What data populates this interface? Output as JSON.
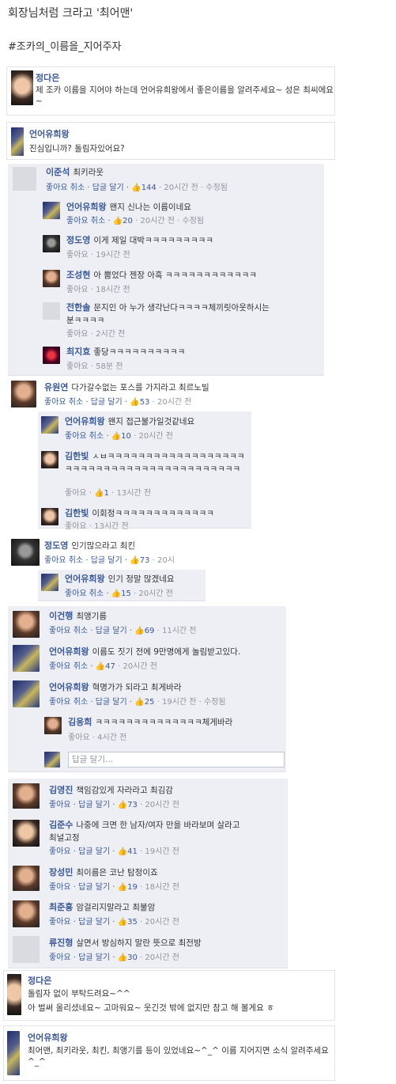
{
  "header": {
    "title": "회장님처럼 크라고 '최어맨'",
    "hashtag": "#조카의_이름을_지어주자"
  },
  "post1": {
    "name": "정다은",
    "text": "제 조카 이름을 지어야 하는데 언어유희왕에서 좋은이름을 알려주세요~ 성은 최씨에요~"
  },
  "post2": {
    "name": "언어유희왕",
    "text": "진심입니까? 돌림자있어요?"
  },
  "labels": {
    "like": "좋아요",
    "cancel": "취소",
    "reply": "답글 달기",
    "reply_placeholder": "답글 달기...",
    "edited": "수정됨"
  },
  "c1": {
    "name": "이준석",
    "text": "최키라웃",
    "meta": "좋아요 취소 · 답글 달기 · ",
    "likes": "144",
    "time": "20시간 전",
    "edited": "수정됨"
  },
  "r1": {
    "name": "언어유희왕",
    "text": "왠지 신나는 이름이네요",
    "meta": "좋아요 취소 · ",
    "likes": "20",
    "time": "20시간 전",
    "edited": "수정됨"
  },
  "r2": {
    "name": "정도영",
    "text": "이게 제일 대박ㅋㅋㅋㅋㅋㅋㅋㅋㅋ",
    "meta": "좋아요 · 19시간 전"
  },
  "r3": {
    "name": "조성현",
    "text": "아 뿜었다 젠장 아흑 ㅋㅋㅋㅋㅋㅋㅋㅋㅋㅋㅋㅋ",
    "meta": "좋아요 · 18시간 전"
  },
  "r4": {
    "name": "전한솔",
    "text": "문지인 아 누가 생각난다ㅋㅋㅋㅋ체끼릿아웃하시는",
    "text2": "분ㅋㅋㅋㅋ",
    "meta": "좋아요 · 2시간 전"
  },
  "r5": {
    "name": "최지효",
    "text": "좋당ㅋㅋㅋㅋㅋㅋㅋㅋㅋㅋ",
    "meta": "좋아요 · 58분 전"
  },
  "c2": {
    "name": "유원연",
    "text": "다가갈수없는 포스를 가지라고 최르노빌",
    "meta": "좋아요 취소 · 답글 달기 · ",
    "likes": "53",
    "time": "20시간 전"
  },
  "r6": {
    "name": "언어유희왕",
    "text": "왠지 접근불가일것같네요",
    "meta": "좋아요 취소 · ",
    "likes": "10",
    "time": "20시간 전"
  },
  "r7": {
    "name": "김한빛",
    "text": "ㅅㅂㅋㅋㅋㅋㅋㅋㅋㅋㅋㅋㅋㅋㅋㅋㅋㅋㅋㅋ",
    "text2": "ㅋㅋㅋㅋㅋㅋㅋㅋㅋㅋㅋㅋㅋㅋㅋㅋㅋㅋㅋㅋㅋㅋㅋ",
    "meta": "좋아요 · ",
    "likes": "1",
    "time": "13시간 전"
  },
  "r8": {
    "name": "김한빛",
    "text": "이회정ㅋㅋㅋㅋㅋㅋㅋㅋㅋㅋㅋㅋㅋ",
    "meta": "좋아요 · 13시간 전"
  },
  "c3": {
    "name": "정도영",
    "text": "인기많으라고 최킨",
    "meta": "좋아요 취소 · 답글 달기 · ",
    "likes": "73",
    "time": "20시"
  },
  "r9": {
    "name": "언어유희왕",
    "text": "인기 정말 많겠네요",
    "meta": "좋아요 취소 · ",
    "likes": "15",
    "time": "20시간 전"
  },
  "c4": {
    "name": "이건행",
    "text": "최앵기름",
    "meta": "좋아요 취소 · 답글 달기 · ",
    "likes": "69",
    "time": "11시간 전"
  },
  "c5": {
    "name": "언어유희왕",
    "text": "이름도 짓기 전에 9만명에게 놀림받고있다.",
    "meta": "좋아요 취소 · ",
    "likes": "47",
    "time": "20시간 전"
  },
  "c6": {
    "name": "언어유희왕",
    "text": "혁명가가 되라고 최게바라",
    "meta": "좋아요 취소 · 답글 달기 · ",
    "likes": "25",
    "time": "19시간 전",
    "edited": "수정됨"
  },
  "r10": {
    "name": "김응희",
    "text": "ㅋㅋㅋㅋㅋㅋㅋㅋㅋㅋㅋㅋㅋㅋ체게바라",
    "meta": "좋아요 · 4시간 전"
  },
  "c7": {
    "name": "김영진",
    "text": "책임감있게 자라라고 최김감",
    "meta": "좋아요 · 답글 달기 · ",
    "likes": "73",
    "time": "20시간 전"
  },
  "c8": {
    "name": "김준수",
    "text": "나중에 크면 한 남자/여자 만을 바라보며 살라고",
    "text2": "최널고정",
    "meta": "좋아요 · 답글 달기 · ",
    "likes": "41",
    "time": "19시간 전"
  },
  "c9": {
    "name": "장성민",
    "text": "최이름은 코난 탐정이죠",
    "meta": "좋아요 · 답글 달기 · ",
    "likes": "19",
    "time": "18시간 전"
  },
  "c10": {
    "name": "최준홍",
    "text": "암걸리지말라고 최불암",
    "meta": "좋아요 · 답글 달기 · ",
    "likes": "35",
    "time": "20시간 전"
  },
  "c11": {
    "name": "류진형",
    "text": "살면서 방심하지 말란 뜻으로 최전방",
    "meta": "좋아요 · 답글 달기 · ",
    "likes": "30",
    "time": "20시간 전"
  },
  "post3": {
    "name": "정다은",
    "text": "돌림자 없이 부탁드려요~^^",
    "text2": "아 벌써 올리셨네요~ 고마워요~ 웃긴것 밖에 없지만 참고 해 볼게요 ㅎ"
  },
  "post4": {
    "name": "언어유희왕",
    "text": "최어맨, 최키라웃, 최킨, 최앵기를 등이 있었네요~^_^ 이름 지어지면 소식 알려주세요^_^"
  },
  "icons": {
    "thumb": "thumbs-up-icon"
  },
  "colors": {
    "link": "#3b5998",
    "comment_bg": "#edeff4",
    "meta": "#90949c"
  }
}
